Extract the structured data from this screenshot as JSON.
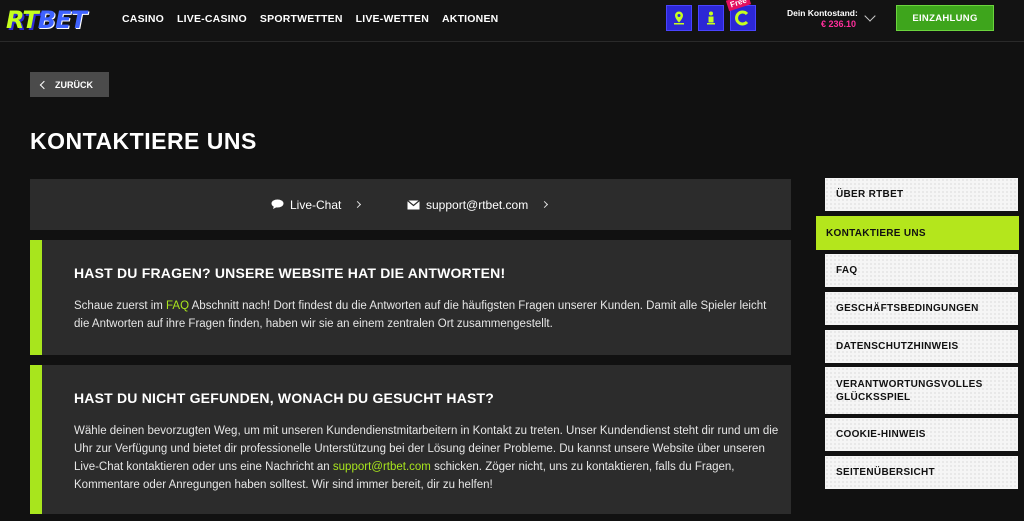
{
  "header": {
    "logo": {
      "part1": "RT",
      "part2": "BET"
    },
    "nav": [
      "CASINO",
      "LIVE-CASINO",
      "SPORTWETTEN",
      "LIVE-WETTEN",
      "AKTIONEN"
    ],
    "icons": [
      "map-pin-icon",
      "info-person-icon",
      "free-coin-icon"
    ],
    "free_tag": "Free",
    "balance_label": "Dein Kontostand:",
    "balance_value": "€ 236.10",
    "deposit_label": "EINZAHLUNG",
    "colors": {
      "lime": "#a8e51d",
      "blue": "#2c27d6",
      "pink": "#ff2e9b",
      "green": "#3ea51c"
    }
  },
  "back_label": "ZURÜCK",
  "page_title": "KONTAKTIERE UNS",
  "contact": {
    "live_chat": "Live-Chat",
    "email": "support@rtbet.com"
  },
  "sections": [
    {
      "title": "HAST DU FRAGEN? UNSERE WEBSITE HAT DIE ANTWORTEN!",
      "text_before": "Schaue zuerst im ",
      "link": "FAQ",
      "text_after": " Abschnitt nach! Dort findest du die Antworten auf die häufigsten Fragen unserer Kunden. Damit alle Spieler leicht die Antworten auf ihre Fragen finden, haben wir sie an einem zentralen Ort zusammengestellt."
    },
    {
      "title": "HAST DU NICHT GEFUNDEN, WONACH DU GESUCHT HAST?",
      "text_before": "Wähle deinen bevorzugten Weg, um mit unseren Kundendienstmitarbeitern in Kontakt zu treten. Unser Kundendienst steht dir rund um die Uhr zur Verfügung und bietet dir professionelle Unterstützung bei der Lösung deiner Probleme. Du kannst unsere Website über unseren Live-Chat kontaktieren oder uns eine Nachricht an ",
      "link": "support@rtbet.com",
      "text_after": " schicken. Zöger nicht, uns zu kontaktieren, falls du Fragen, Kommentare oder Anregungen haben solltest. Wir sind immer bereit, dir zu helfen!"
    }
  ],
  "sidebar": [
    {
      "label": "ÜBER RTBET"
    },
    {
      "label": "KONTAKTIERE UNS",
      "active": true
    },
    {
      "label": "FAQ"
    },
    {
      "label": "GESCHÄFTSBEDINGUNGEN"
    },
    {
      "label": "DATENSCHUTZHINWEIS"
    },
    {
      "label": "VERANTWORTUNGSVOLLES GLÜCKSSPIEL"
    },
    {
      "label": "COOKIE-HINWEIS"
    },
    {
      "label": "SEITENÜBERSICHT"
    }
  ]
}
